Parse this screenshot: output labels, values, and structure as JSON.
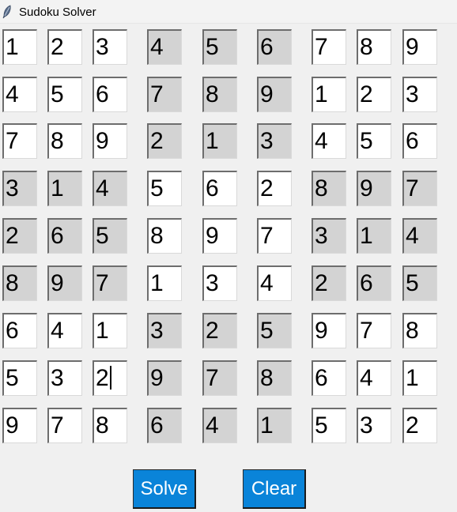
{
  "window": {
    "title": "Sudoku Solver",
    "icon": "feather-icon"
  },
  "grid": {
    "rows": [
      [
        "1",
        "2",
        "3",
        "4",
        "5",
        "6",
        "7",
        "8",
        "9"
      ],
      [
        "4",
        "5",
        "6",
        "7",
        "8",
        "9",
        "1",
        "2",
        "3"
      ],
      [
        "7",
        "8",
        "9",
        "2",
        "1",
        "3",
        "4",
        "5",
        "6"
      ],
      [
        "3",
        "1",
        "4",
        "5",
        "6",
        "2",
        "8",
        "9",
        "7"
      ],
      [
        "2",
        "6",
        "5",
        "8",
        "9",
        "7",
        "3",
        "1",
        "4"
      ],
      [
        "8",
        "9",
        "7",
        "1",
        "3",
        "4",
        "2",
        "6",
        "5"
      ],
      [
        "6",
        "4",
        "1",
        "3",
        "2",
        "5",
        "9",
        "7",
        "8"
      ],
      [
        "5",
        "3",
        "2",
        "9",
        "7",
        "8",
        "6",
        "4",
        "1"
      ],
      [
        "9",
        "7",
        "8",
        "6",
        "4",
        "1",
        "5",
        "3",
        "2"
      ]
    ],
    "focused_cell": [
      7,
      2
    ]
  },
  "buttons": {
    "solve_label": "Solve",
    "clear_label": "Clear"
  },
  "colors": {
    "shaded_block": "#d3d3d3",
    "cell_background": "#ffffff",
    "button_background": "#0a84d9",
    "button_text": "#ffffff",
    "window_background": "#f0f0f0"
  }
}
